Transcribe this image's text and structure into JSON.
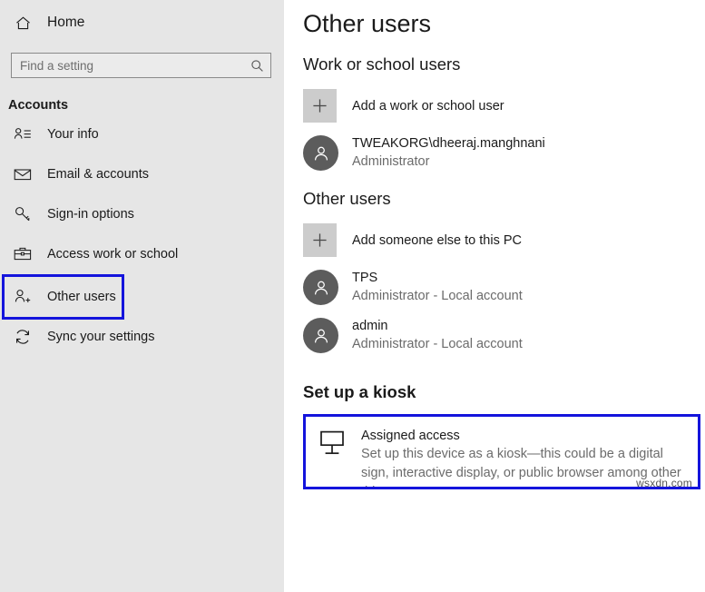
{
  "sidebar": {
    "home": {
      "label": "Home",
      "icon": "home-icon"
    },
    "search": {
      "placeholder": "Find a setting",
      "value": "",
      "icon": "search-icon"
    },
    "section_title": "Accounts",
    "items": [
      {
        "label": "Your info",
        "icon": "person-card-icon",
        "selected": false
      },
      {
        "label": "Email & accounts",
        "icon": "envelope-icon",
        "selected": false
      },
      {
        "label": "Sign-in options",
        "icon": "key-icon",
        "selected": false
      },
      {
        "label": "Access work or school",
        "icon": "briefcase-icon",
        "selected": false
      },
      {
        "label": "Other users",
        "icon": "person-add-icon",
        "selected": true
      },
      {
        "label": "Sync your settings",
        "icon": "sync-icon",
        "selected": false
      }
    ]
  },
  "main": {
    "page_title": "Other users",
    "work_school": {
      "heading": "Work or school users",
      "add_action": {
        "label": "Add a work or school user",
        "icon": "plus-icon"
      },
      "users": [
        {
          "name": "TWEAKORG\\dheeraj.manghnani",
          "role": "Administrator",
          "icon": "avatar-person-icon"
        }
      ]
    },
    "other_users": {
      "heading": "Other users",
      "add_action": {
        "label": "Add someone else to this PC",
        "icon": "plus-icon"
      },
      "users": [
        {
          "name": "TPS",
          "role": "Administrator - Local account",
          "icon": "avatar-person-icon"
        },
        {
          "name": "admin",
          "role": "Administrator - Local account",
          "icon": "avatar-person-icon"
        }
      ]
    },
    "kiosk": {
      "heading": "Set up a kiosk",
      "card": {
        "icon": "monitor-icon",
        "title": "Assigned access",
        "description": "Set up this device as a kiosk—this could be a digital sign, interactive display, or public browser among other things."
      }
    },
    "watermark": "wsxdn.com"
  },
  "colors": {
    "highlight": "#1414dc",
    "sidebar_bg": "#e6e6e6",
    "avatar_bg": "#5c5c5c",
    "tile_bg": "#cccccc",
    "secondary_text": "#6b6b6b"
  }
}
